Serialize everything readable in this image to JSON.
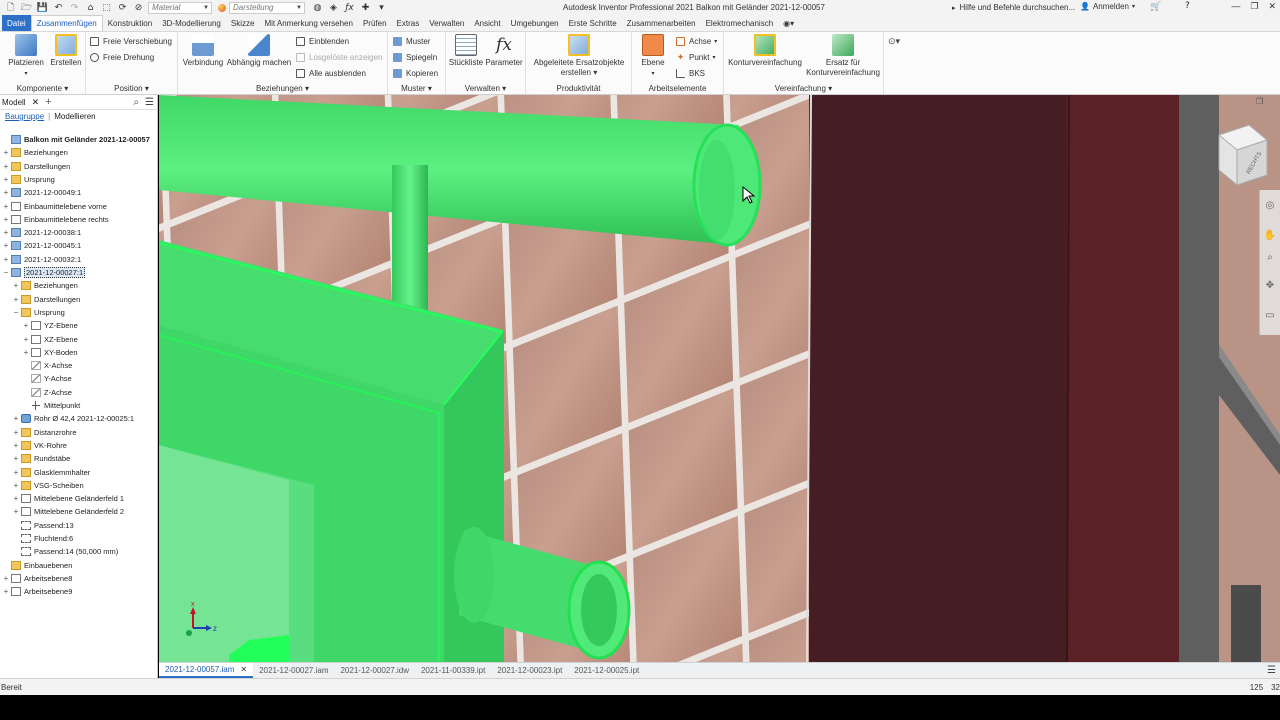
{
  "titlebar": {
    "material_placeholder": "Material",
    "appearance_placeholder": "Darstellung",
    "title": "Autodesk Inventor Professional 2021     Balkon mit Geländer 2021-12-00057",
    "help_search": "Hilfe und Befehle durchsuchen...",
    "sign_in": "Anmelden"
  },
  "tabs": [
    {
      "label": "Datei"
    },
    {
      "label": "Zusammenfügen"
    },
    {
      "label": "Konstruktion"
    },
    {
      "label": "3D-Modellierung"
    },
    {
      "label": "Skizze"
    },
    {
      "label": "Mit Anmerkung versehen"
    },
    {
      "label": "Prüfen"
    },
    {
      "label": "Extras"
    },
    {
      "label": "Verwalten"
    },
    {
      "label": "Ansicht"
    },
    {
      "label": "Umgebungen"
    },
    {
      "label": "Erste Schritte"
    },
    {
      "label": "Zusammenarbeiten"
    },
    {
      "label": "Elektromechanisch"
    }
  ],
  "ribbon": {
    "komponente": {
      "label": "Komponente",
      "platzieren": "Platzieren",
      "erstellen": "Erstellen"
    },
    "position": {
      "label": "Position",
      "freie_verschiebung": "Freie Verschiebung",
      "freie_drehung": "Freie Drehung"
    },
    "beziehungen": {
      "label": "Beziehungen",
      "verbindung": "Verbindung",
      "abhaengig": "Abhängig machen",
      "einblenden": "Einblenden",
      "losgeloeste": "Losgelöste anzeigen",
      "alle_ausblenden": "Alle ausblenden"
    },
    "muster": {
      "label": "Muster",
      "muster": "Muster",
      "spiegeln": "Spiegeln",
      "kopieren": "Kopieren"
    },
    "verwalten": {
      "label": "Verwalten",
      "stueckliste": "Stückliste",
      "parameter": "Parameter"
    },
    "produktivitaet": {
      "label": "Produktivität",
      "abgeleitete_1": "Abgeleitete Ersatzobjekte",
      "abgeleitete_2": "erstellen"
    },
    "arbeitselemente": {
      "label": "Arbeitselemente",
      "ebene": "Ebene",
      "achse": "Achse",
      "punkt": "Punkt",
      "bks": "BKS"
    },
    "vereinfachung": {
      "label": "Vereinfachung",
      "kontur": "Konturvereinfachung",
      "ersatz_1": "Ersatz für",
      "ersatz_2": "Konturvereinfachung"
    }
  },
  "browser": {
    "tab": "Modell",
    "sub_tabs": [
      "Baugruppe",
      "Modellieren"
    ],
    "tree": [
      {
        "label": "Balkon mit Geländer 2021-12-00057",
        "icon": "asm",
        "level": 0,
        "exp": "",
        "root": true
      },
      {
        "label": "Beziehungen",
        "icon": "folder",
        "level": 0,
        "exp": "+"
      },
      {
        "label": "Darstellungen",
        "icon": "folder",
        "level": 0,
        "exp": "+"
      },
      {
        "label": "Ursprung",
        "icon": "folder",
        "level": 0,
        "exp": "+"
      },
      {
        "label": "2021-12-00049:1",
        "icon": "asm",
        "level": 0,
        "exp": "+"
      },
      {
        "label": "Einbaumittelebene vorne",
        "icon": "plane",
        "level": 0,
        "exp": "+"
      },
      {
        "label": "Einbaumittelebene rechts",
        "icon": "plane",
        "level": 0,
        "exp": "+"
      },
      {
        "label": "2021-12-00038:1",
        "icon": "asm",
        "level": 0,
        "exp": "+"
      },
      {
        "label": "2021-12-00045:1",
        "icon": "asm",
        "level": 0,
        "exp": "+"
      },
      {
        "label": "2021-12-00032:1",
        "icon": "asm",
        "level": 0,
        "exp": "+"
      },
      {
        "label": "2021-12-00027:1",
        "icon": "asm",
        "level": 0,
        "exp": "−",
        "selected": true
      },
      {
        "label": "Beziehungen",
        "icon": "folder",
        "level": 1,
        "exp": "+"
      },
      {
        "label": "Darstellungen",
        "icon": "folder",
        "level": 1,
        "exp": "+"
      },
      {
        "label": "Ursprung",
        "icon": "folder",
        "level": 1,
        "exp": "−"
      },
      {
        "label": "YZ-Ebene",
        "icon": "plane",
        "level": 2,
        "exp": "+"
      },
      {
        "label": "XZ-Ebene",
        "icon": "plane",
        "level": 2,
        "exp": "+"
      },
      {
        "label": "XY-Boden",
        "icon": "plane",
        "level": 2,
        "exp": "+"
      },
      {
        "label": "X-Achse",
        "icon": "axis",
        "level": 2,
        "exp": ""
      },
      {
        "label": "Y-Achse",
        "icon": "axis",
        "level": 2,
        "exp": ""
      },
      {
        "label": "Z-Achse",
        "icon": "axis",
        "level": 2,
        "exp": ""
      },
      {
        "label": "Mittelpunkt",
        "icon": "pt",
        "level": 2,
        "exp": ""
      },
      {
        "label": "Rohr Ø 42,4 2021-12-00025:1",
        "icon": "part",
        "level": 1,
        "exp": "+"
      },
      {
        "label": "Distanzrohre",
        "icon": "folder",
        "level": 1,
        "exp": "+"
      },
      {
        "label": "VK-Rohre",
        "icon": "folder",
        "level": 1,
        "exp": "+"
      },
      {
        "label": "Rundstäbe",
        "icon": "folder",
        "level": 1,
        "exp": "+"
      },
      {
        "label": "Glasklemmhalter",
        "icon": "folder",
        "level": 1,
        "exp": "+"
      },
      {
        "label": "VSG-Scheiben",
        "icon": "folder",
        "level": 1,
        "exp": "+"
      },
      {
        "label": "Mittelebene Geländerfeld 1",
        "icon": "plane",
        "level": 1,
        "exp": "+"
      },
      {
        "label": "Mittelebene Geländerfeld 2",
        "icon": "plane",
        "level": 1,
        "exp": "+"
      },
      {
        "label": "Passend:13",
        "icon": "cons",
        "level": 1,
        "exp": ""
      },
      {
        "label": "Fluchtend:6",
        "icon": "cons",
        "level": 1,
        "exp": ""
      },
      {
        "label": "Passend:14 (50,000 mm)",
        "icon": "cons",
        "level": 1,
        "exp": ""
      },
      {
        "label": "Einbauebenen",
        "icon": "folder",
        "level": 0,
        "exp": ""
      },
      {
        "label": "Arbeitsebene8",
        "icon": "plane",
        "level": 0,
        "exp": "+"
      },
      {
        "label": "Arbeitsebene9",
        "icon": "plane",
        "level": 0,
        "exp": "+"
      }
    ]
  },
  "viewcube_label": "RECHTS",
  "doc_tabs": [
    {
      "label": "2021-12-00057.iam",
      "active": true
    },
    {
      "label": "2021-12-00027.iam"
    },
    {
      "label": "2021-12-00027.idw"
    },
    {
      "label": "2021-11-00339.ipt"
    },
    {
      "label": "2021-12-00023.ipt"
    },
    {
      "label": "2021-12-00025.ipt"
    }
  ],
  "status": {
    "text": "Bereit",
    "x": "125",
    "y": "32"
  },
  "colors": {
    "accent": "#2c71c7",
    "highlight_green": "#3ee06a",
    "tile": "#c89b8a",
    "wall": "#4a1f24"
  }
}
